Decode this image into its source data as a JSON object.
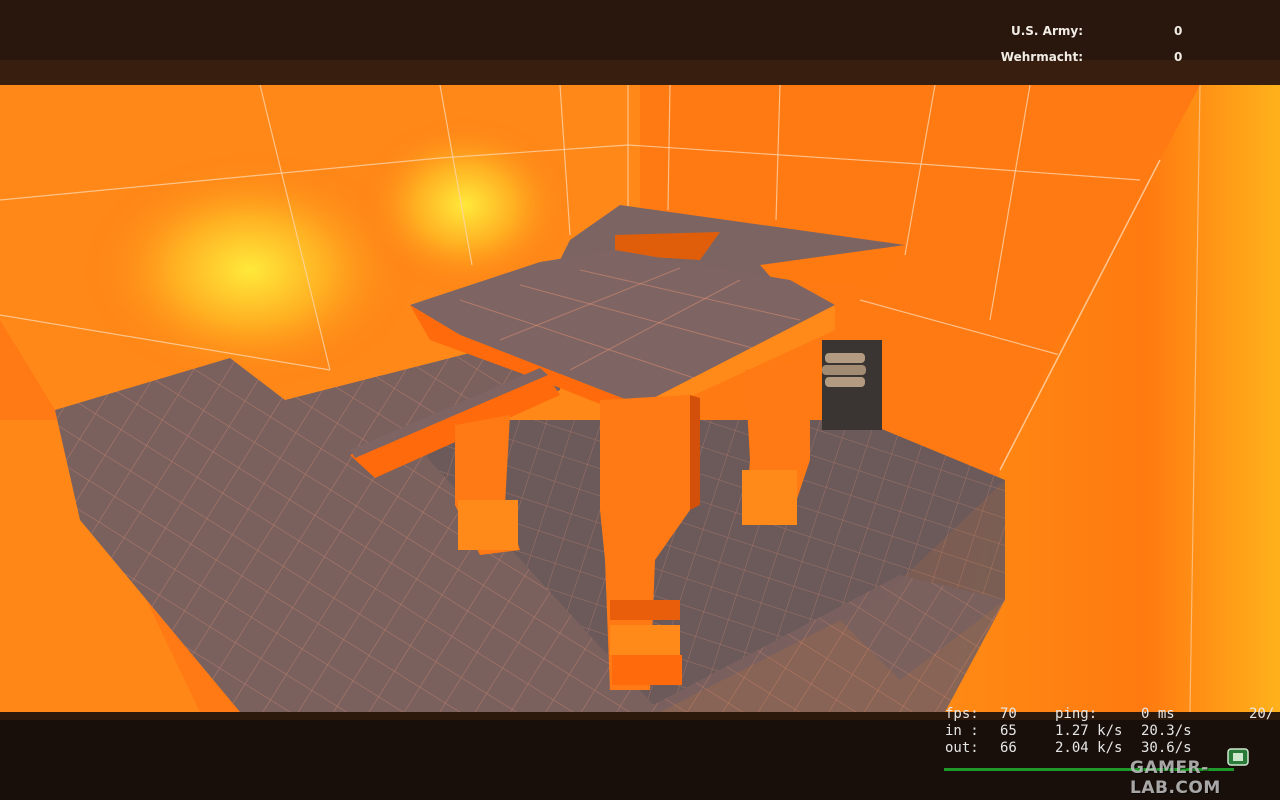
{
  "scoreboard": {
    "teams": [
      {
        "name": "U.S. Army:",
        "score": "0"
      },
      {
        "name": "Wehrmacht:",
        "score": "0"
      }
    ]
  },
  "netgraph": {
    "rows": [
      {
        "label": "fps:",
        "value": "70",
        "c2": "ping:",
        "c3": "0 ms"
      },
      {
        "label": "in :",
        "value": "65",
        "c2": "1.27 k/s",
        "c3": "20.3/s"
      },
      {
        "label": "out:",
        "value": "66",
        "c2": "2.04 k/s",
        "c3": "30.6/s"
      }
    ],
    "corner": "20/"
  },
  "watermark": "GAMER-LAB.COM",
  "colors": {
    "wall": "#ff7a12",
    "wall_glow": "#ffe033",
    "floor": "#7a615e",
    "grid": "#ff9a78",
    "hud_bar": "#2c180e",
    "netgraph_line": "#1e9a2a"
  }
}
